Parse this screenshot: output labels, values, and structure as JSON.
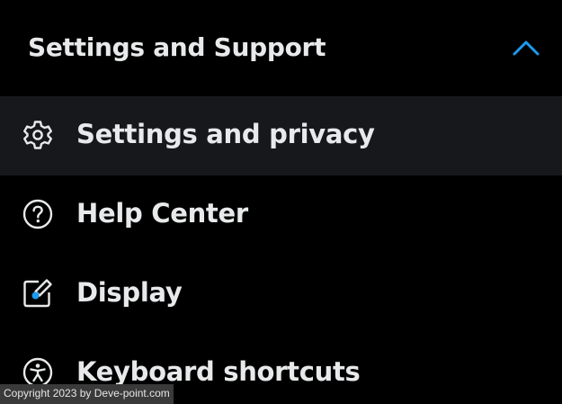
{
  "section": {
    "title": "Settings and Support",
    "expanded": true,
    "chevron_icon": "chevron-up-icon",
    "accent_color": "#1d9bf0"
  },
  "menu": {
    "items": [
      {
        "label": "Settings and privacy",
        "icon": "gear-icon",
        "active": true
      },
      {
        "label": "Help Center",
        "icon": "help-circle-icon",
        "active": false
      },
      {
        "label": "Display",
        "icon": "display-edit-icon",
        "active": false
      },
      {
        "label": "Keyboard shortcuts",
        "icon": "accessibility-icon",
        "active": false
      }
    ]
  },
  "watermark": {
    "text": "Copyright 2023 by Deve-point.com"
  },
  "colors": {
    "background": "#000000",
    "active_row": "#16181c",
    "text": "#e7e9ea"
  }
}
